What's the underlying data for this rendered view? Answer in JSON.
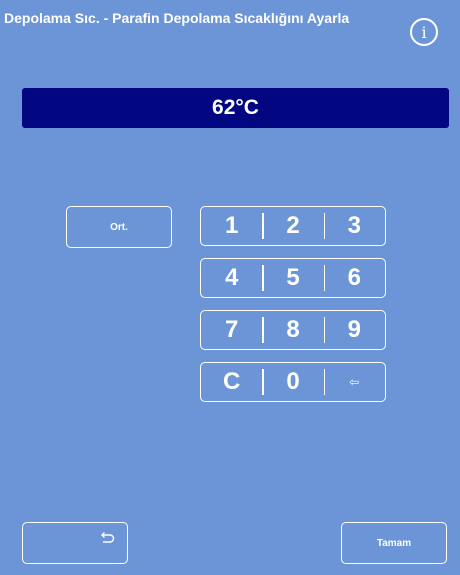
{
  "header": {
    "title": "Depolama Sıc. - Parafin Depolama Sıcaklığını Ayarla",
    "info_icon": "info-icon",
    "info_glyph": "i"
  },
  "display": {
    "value": "62°C",
    "background_color": "#020680"
  },
  "buttons": {
    "average_label": "Ort.",
    "ok_label": "Tamam",
    "back_icon": "undo-arrow-icon"
  },
  "keypad": {
    "rows": [
      [
        "1",
        "2",
        "3"
      ],
      [
        "4",
        "5",
        "6"
      ],
      [
        "7",
        "8",
        "9"
      ],
      [
        "C",
        "0",
        "⇦"
      ]
    ]
  },
  "colors": {
    "background": "#6b95d6",
    "text": "#ffffff"
  }
}
